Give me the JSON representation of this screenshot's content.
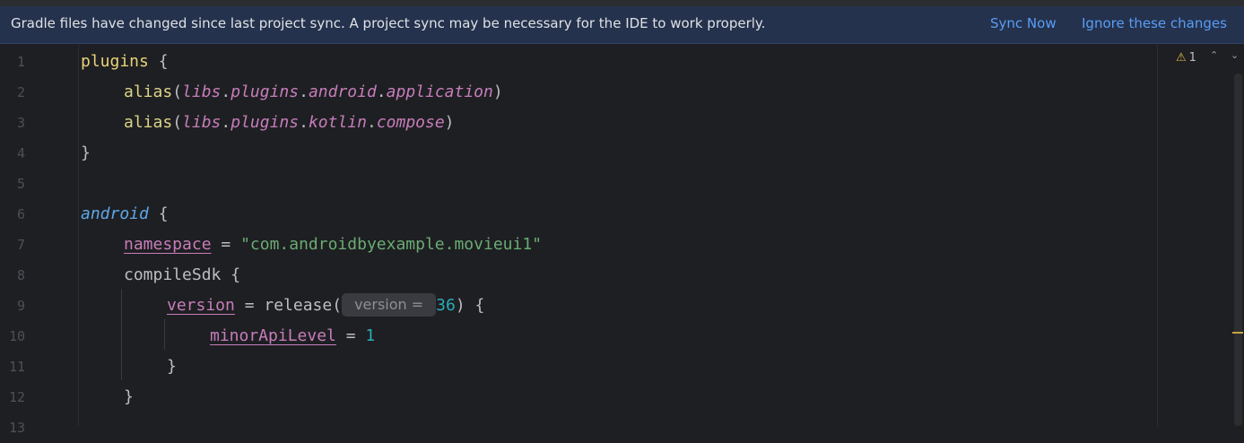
{
  "banner": {
    "message": "Gradle files have changed since last project sync. A project sync may be necessary for the IDE to work properly.",
    "sync_now": "Sync Now",
    "ignore": "Ignore these changes"
  },
  "inspection": {
    "warning_count": "1",
    "warn_icon": "warning-triangle-icon",
    "prev_icon": "chevron-up-icon",
    "next_icon": "chevron-down-icon"
  },
  "line_numbers": [
    "1",
    "2",
    "3",
    "4",
    "5",
    "6",
    "7",
    "8",
    "9",
    "10",
    "11",
    "12",
    "13"
  ],
  "code": {
    "l1_kw": "plugins",
    "l1_brace": " {",
    "l2_fn": "alias",
    "l2_open": "(",
    "l2_p1": "libs",
    "l2_d1": ".",
    "l2_p2": "plugins",
    "l2_d2": ".",
    "l2_p3": "android",
    "l2_d3": ".",
    "l2_p4": "application",
    "l2_close": ")",
    "l3_fn": "alias",
    "l3_open": "(",
    "l3_p1": "libs",
    "l3_d1": ".",
    "l3_p2": "plugins",
    "l3_d2": ".",
    "l3_p3": "kotlin",
    "l3_d3": ".",
    "l3_p4": "compose",
    "l3_close": ")",
    "l4": "}",
    "l6_ref": "android",
    "l6_brace": " {",
    "l7_prop": "namespace",
    "l7_eq": " = ",
    "l7_str": "\"com.androidbyexample.movieui1\"",
    "l8_fn": "compileSdk",
    "l8_brace": " {",
    "l9_prop": "version",
    "l9_eq": " = ",
    "l9_call": "release(",
    "l9_hint": "version =",
    "l9_num": "36",
    "l9_close": ") {",
    "l10_prop": "minorApiLevel",
    "l10_eq": " = ",
    "l10_num": "1",
    "l11": "}",
    "l12": "}"
  }
}
